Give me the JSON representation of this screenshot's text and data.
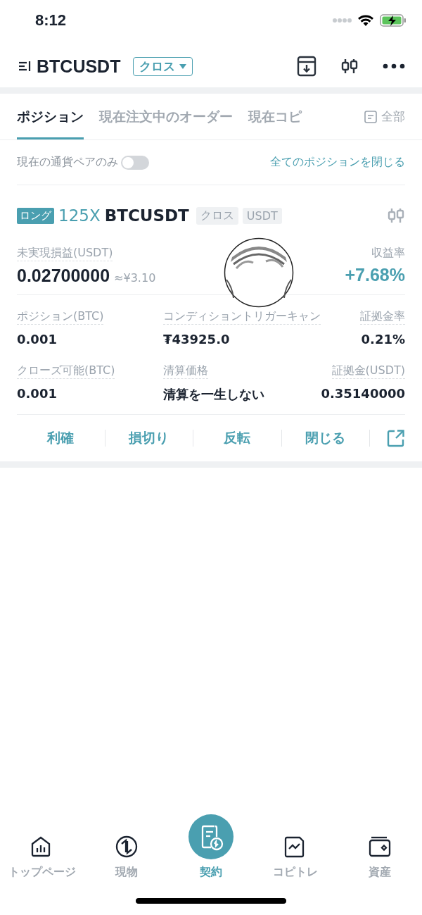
{
  "status_bar": {
    "time": "8:12"
  },
  "header": {
    "symbol": "BTCUSDT",
    "margin_mode": "クロス"
  },
  "tabs": [
    {
      "label": "ポジション",
      "selected": true
    },
    {
      "label": "現在注文中のオーダー",
      "selected": false
    },
    {
      "label": "現在コピ",
      "selected": false
    }
  ],
  "filter": {
    "label": "全部"
  },
  "toggle_row": {
    "label": "現在の通貨ペアのみ",
    "on": false,
    "close_all": "全てのポジションを閉じる"
  },
  "position": {
    "side": "ロング",
    "leverage": "125X",
    "symbol": "BTCUSDT",
    "tags": [
      "クロス",
      "USDT"
    ],
    "pnl_label": "未実現損益(USDT)",
    "pnl": "0.02700000",
    "pnl_approx": "≈¥3.10",
    "roe_label": "収益率",
    "roe": "+7.68%",
    "fields": [
      {
        "label": "ポジション(BTC)",
        "value": "0.001"
      },
      {
        "label": "コンディショントリガーキャン",
        "value": "₮43925.0"
      },
      {
        "label": "証拠金率",
        "value": "0.21%"
      },
      {
        "label": "クローズ可能(BTC)",
        "value": "0.001"
      },
      {
        "label": "清算価格",
        "value": "清算を一生しない"
      },
      {
        "label": "証拠金(USDT)",
        "value": "0.35140000"
      }
    ],
    "actions": [
      "利確",
      "損切り",
      "反転",
      "閉じる"
    ]
  },
  "nav": [
    {
      "label": "トップページ",
      "kind": "home",
      "selected": false
    },
    {
      "label": "現物",
      "kind": "spot",
      "selected": false
    },
    {
      "label": "契約",
      "kind": "contract",
      "selected": true
    },
    {
      "label": "コピトレ",
      "kind": "chart",
      "selected": false
    },
    {
      "label": "資産",
      "kind": "wallet",
      "selected": false
    }
  ]
}
